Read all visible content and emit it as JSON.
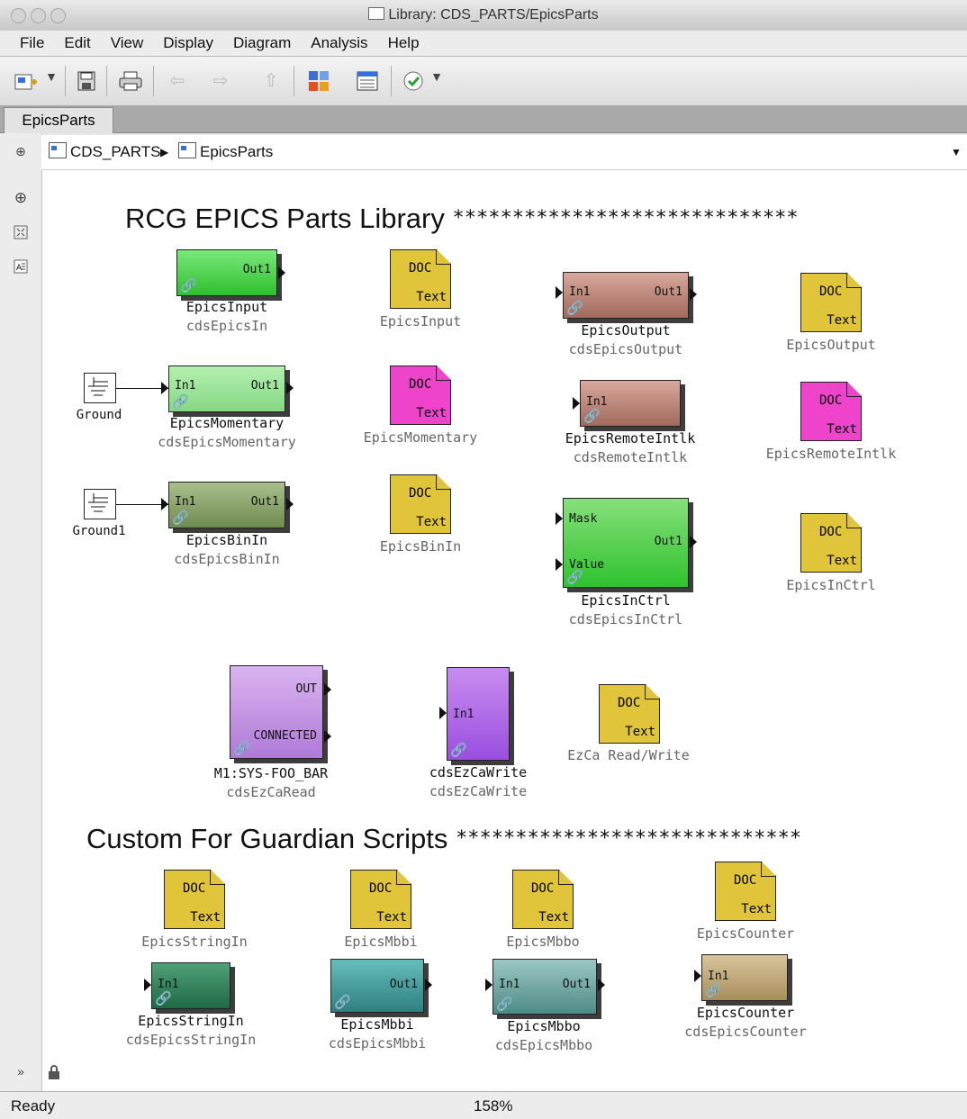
{
  "window": {
    "title": "Library: CDS_PARTS/EpicsParts"
  },
  "menu": [
    "File",
    "Edit",
    "View",
    "Display",
    "Diagram",
    "Analysis",
    "Help"
  ],
  "tab": "EpicsParts",
  "breadcrumb": {
    "root": "CDS_PARTS",
    "current": "EpicsParts"
  },
  "status": {
    "left": "Ready",
    "zoom": "158%"
  },
  "headings": {
    "library": "RCG EPICS Parts Library",
    "library_stars": "*****************************",
    "guardian": "Custom For Guardian Scripts",
    "guardian_stars": "*****************************"
  },
  "doc": {
    "top": "DOC",
    "bottom": "Text"
  },
  "blocks": {
    "epicsInput": {
      "name": "EpicsInput",
      "sub": "cdsEpicsIn",
      "out": "Out1"
    },
    "epicsOutput": {
      "name": "EpicsOutput",
      "sub": "cdsEpicsOutput",
      "in": "In1",
      "out": "Out1"
    },
    "epicsMomentary": {
      "name": "EpicsMomentary",
      "sub": "cdsEpicsMomentary",
      "in": "In1",
      "out": "Out1"
    },
    "epicsRemoteIntlk": {
      "name": "EpicsRemoteIntlk",
      "sub": "cdsRemoteIntlk",
      "in": "In1"
    },
    "epicsBinIn": {
      "name": "EpicsBinIn",
      "sub": "cdsEpicsBinIn",
      "in": "In1",
      "out": "Out1"
    },
    "epicsInCtrl": {
      "name": "EpicsInCtrl",
      "sub": "cdsEpicsInCtrl",
      "in1": "Mask",
      "in2": "Value",
      "out": "Out1"
    },
    "ezCaRead": {
      "name": "M1:SYS-FOO_BAR",
      "sub": "cdsEzCaRead",
      "out1": "OUT",
      "out2": "CONNECTED"
    },
    "ezCaWrite": {
      "name": "cdsEzCaWrite",
      "sub": "cdsEzCaWrite",
      "in": "In1"
    },
    "epicsStringIn": {
      "name": "EpicsStringIn",
      "sub": "cdsEpicsStringIn",
      "in": "In1"
    },
    "epicsMbbi": {
      "name": "EpicsMbbi",
      "sub": "cdsEpicsMbbi",
      "out": "Out1"
    },
    "epicsMbbo": {
      "name": "EpicsMbbo",
      "sub": "cdsEpicsMbbo",
      "in": "In1",
      "out": "Out1"
    },
    "epicsCounter": {
      "name": "EpicsCounter",
      "sub": "cdsEpicsCounter",
      "in": "In1"
    }
  },
  "grounds": {
    "g0": "Ground",
    "g1": "Ground1"
  },
  "docLabels": {
    "epicsInput": "EpicsInput",
    "epicsOutput": "EpicsOutput",
    "epicsMomentary": "EpicsMomentary",
    "epicsRemoteIntlk": "EpicsRemoteIntlk",
    "epicsBinIn": "EpicsBinIn",
    "epicsInCtrl": "EpicsInCtrl",
    "ezca": "EzCa Read/Write",
    "stringIn": "EpicsStringIn",
    "mbbi": "EpicsMbbi",
    "mbbo": "EpicsMbbo",
    "counter": "EpicsCounter"
  },
  "icons": [
    "new-model-icon",
    "save-icon",
    "print-icon",
    "back-icon",
    "forward-icon",
    "up-icon",
    "library-browser-icon",
    "model-explorer-icon",
    "check-icon",
    "expand-icon",
    "zoom-in-icon",
    "fit-icon",
    "annotation-icon",
    "hide-icon",
    "lock-icon"
  ],
  "colors": {
    "green": "#3fcf3f",
    "lightgreen": "#9ce39a",
    "olive": "#7d9a5e",
    "brown": "#b07a6c",
    "brightgreen": "#4fd84f",
    "purple": "#c08ae8",
    "violet": "#a55ee0",
    "teal": "#2f8a5a",
    "cyan": "#3a9a9a",
    "slate": "#5a8a88",
    "tan": "#b8a070",
    "docYellow": "#e0c43a",
    "docMagenta": "#ee44cc"
  }
}
